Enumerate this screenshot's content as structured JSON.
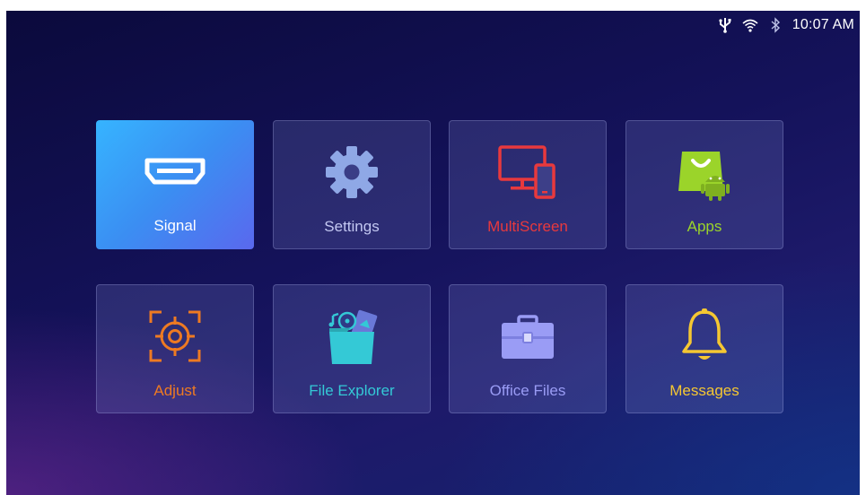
{
  "status": {
    "time": "10:07 AM",
    "icons": [
      "usb-icon",
      "wifi-icon",
      "bluetooth-icon"
    ]
  },
  "tiles": [
    {
      "label": "Signal",
      "color": "#ffffff",
      "icon": "hdmi-icon",
      "selected": true
    },
    {
      "label": "Settings",
      "color": "#c3c8f2",
      "icon": "gear-icon",
      "selected": false
    },
    {
      "label": "MultiScreen",
      "color": "#e8393d",
      "icon": "multiscreen-icon",
      "selected": false
    },
    {
      "label": "Apps",
      "color": "#9bd42a",
      "icon": "android-store-icon",
      "selected": false
    },
    {
      "label": "Adjust",
      "color": "#ee7a22",
      "icon": "crosshair-icon",
      "selected": false
    },
    {
      "label": "File Explorer",
      "color": "#34c9d6",
      "icon": "folder-media-icon",
      "selected": false
    },
    {
      "label": "Office Files",
      "color": "#9a9cf5",
      "icon": "briefcase-icon",
      "selected": false
    },
    {
      "label": "Messages",
      "color": "#f5c732",
      "icon": "bell-icon",
      "selected": false
    }
  ]
}
